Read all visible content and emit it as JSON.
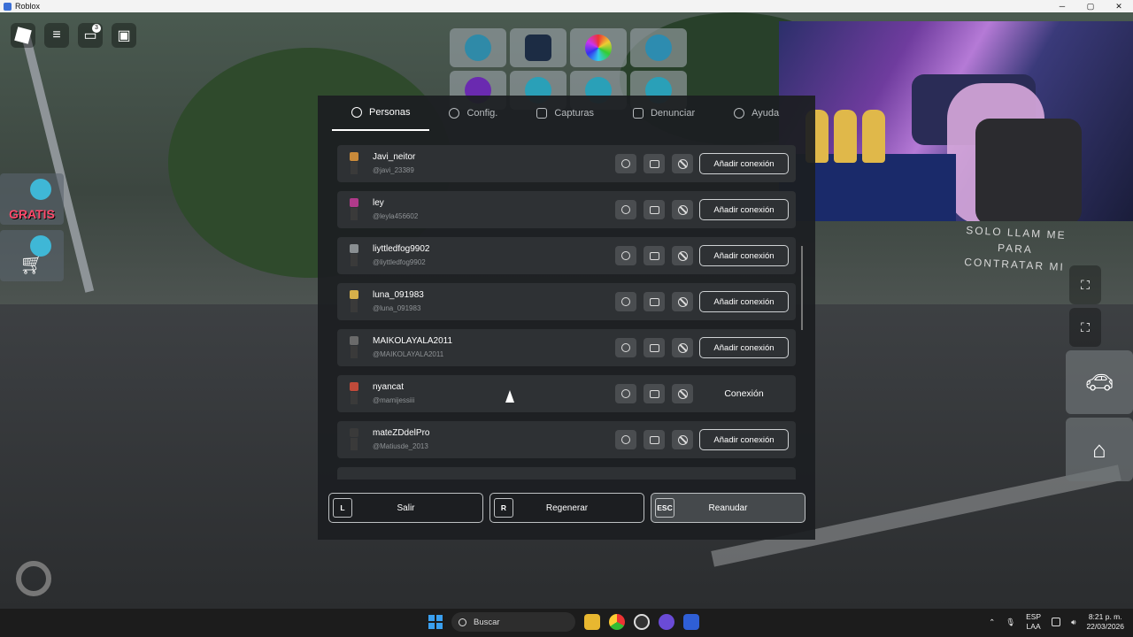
{
  "window": {
    "title": "Roblox",
    "controls": [
      "─",
      "▢",
      "✕"
    ]
  },
  "hud": {
    "notification_count": "3",
    "gratis_label": "GRATIS"
  },
  "scene_sign": {
    "partial_text": "SOLO LLAM ME PARA CONTRATAR MI"
  },
  "menu": {
    "tabs": [
      {
        "label": "Personas",
        "icon": "people-icon",
        "active": true
      },
      {
        "label": "Config.",
        "icon": "gear-icon"
      },
      {
        "label": "Capturas",
        "icon": "camera-icon"
      },
      {
        "label": "Denunciar",
        "icon": "flag-icon"
      },
      {
        "label": "Ayuda",
        "icon": "help-icon"
      }
    ],
    "players": [
      {
        "name": "Javi_neitor",
        "handle": "@javi_23389",
        "action": "Añadir conexión",
        "avatar_color": "#c98a3a"
      },
      {
        "name": "ley",
        "handle": "@leyla456602",
        "action": "Añadir conexión",
        "avatar_color": "#b03a8a"
      },
      {
        "name": "liyttledfog9902",
        "handle": "@liyttledfog9902",
        "action": "Añadir conexión",
        "avatar_color": "#8a8f92"
      },
      {
        "name": "luna_091983",
        "handle": "@luna_091983",
        "action": "Añadir conexión",
        "avatar_color": "#d6b04a"
      },
      {
        "name": "MAIKOLAYALA2011",
        "handle": "@MAIKOLAYALA2011",
        "action": "Añadir conexión",
        "avatar_color": "#6a6a6a"
      },
      {
        "name": "nyancat",
        "handle": "@mamijessiii",
        "action": "Conexión",
        "avatar_color": "#c04a3a"
      },
      {
        "name": "mateZDdelPro",
        "handle": "@Matiusde_2013",
        "action": "Añadir conexión",
        "avatar_color": "#3a3a3a"
      }
    ],
    "buttons": [
      {
        "key": "L",
        "label": "Salir"
      },
      {
        "key": "R",
        "label": "Regenerar"
      },
      {
        "key": "ESC",
        "label": "Reanudar"
      }
    ]
  },
  "taskbar": {
    "search_label": "Buscar",
    "language": "ESP",
    "layout": "LAA",
    "time": "8:21 p. m.",
    "date": "22/03/2026"
  }
}
